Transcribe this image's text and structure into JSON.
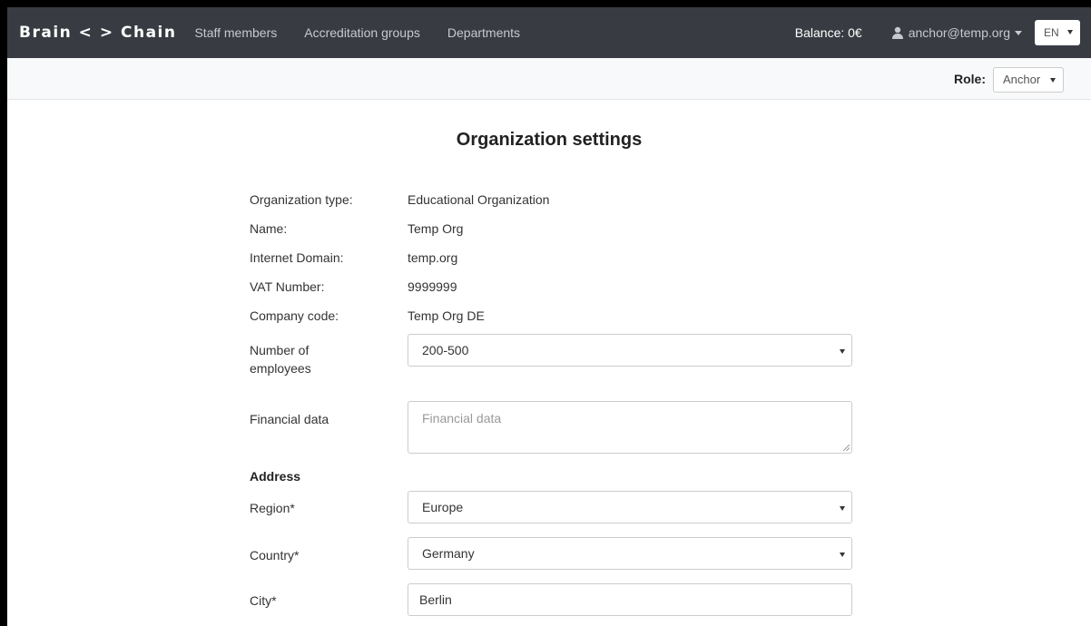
{
  "navbar": {
    "brand": "Brain < > Chain",
    "links": [
      {
        "label": "Staff members"
      },
      {
        "label": "Accreditation groups"
      },
      {
        "label": "Departments"
      }
    ],
    "balance": "Balance: 0€",
    "user": "anchor@temp.org",
    "user_icon": "user-icon",
    "language": "EN"
  },
  "rolebar": {
    "label": "Role:",
    "selected": "Anchor"
  },
  "page": {
    "title": "Organization settings",
    "info": [
      {
        "label": "Organization type:",
        "value": "Educational Organization"
      },
      {
        "label": "Name:",
        "value": "Temp Org"
      },
      {
        "label": "Internet Domain:",
        "value": "temp.org"
      },
      {
        "label": "VAT Number:",
        "value": "9999999"
      },
      {
        "label": "Company code:",
        "value": "Temp Org DE"
      }
    ],
    "employees": {
      "label_line1": "Number of",
      "label_line2": "employees",
      "value": "200-500"
    },
    "financial": {
      "label": "Financial data",
      "placeholder": "Financial data"
    },
    "address_heading": "Address",
    "region": {
      "label": "Region*",
      "value": "Europe"
    },
    "country": {
      "label": "Country*",
      "value": "Germany"
    },
    "city": {
      "label": "City*",
      "value": "Berlin"
    }
  },
  "colors": {
    "navbar_bg": "#383c42",
    "rolebar_bg": "#f8f9fa"
  }
}
